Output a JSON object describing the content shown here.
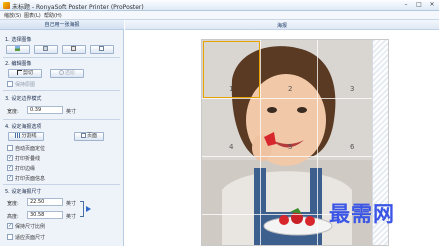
{
  "window": {
    "title": "未标题 - RonyaSoft Poster Printer (ProPoster)",
    "minimize": "–",
    "maximize": "□",
    "close": "✕"
  },
  "menu": {
    "items": [
      "缩放(S)",
      "图表(L)",
      "帮助(H)"
    ]
  },
  "left_panel": {
    "header": "自己用一张海报",
    "step1": {
      "title": "1. 选择图像"
    },
    "step2": {
      "title": "2. 编辑图像",
      "crop": "剪切",
      "restore": "还原",
      "keep_original": "保持原图"
    },
    "step3": {
      "title": "3. 设定边界模式",
      "width_label": "宽度:",
      "width_value": "0.39",
      "width_unit": "英寸"
    },
    "step4": {
      "title": "4. 设定海报选项",
      "segment_btn": "分割线",
      "page_btn": "页面",
      "checks": [
        {
          "label": "自动页面定位",
          "checked": false
        },
        {
          "label": "打印折叠线",
          "checked": true
        },
        {
          "label": "打印边缘",
          "checked": true
        },
        {
          "label": "打印页面信息",
          "checked": true
        }
      ]
    },
    "step5": {
      "title": "5. 设定海报尺寸",
      "width_label": "宽度:",
      "width_value": "22.50",
      "width_unit": "英寸",
      "height_label": "高度:",
      "height_value": "30.58",
      "height_unit": "英寸",
      "keep_ratio": "保持尺寸比例",
      "keep_ratio_checked": true,
      "fit_page": "适应页面尺寸",
      "fit_page_checked": false
    }
  },
  "preview": {
    "header": "海报",
    "tiles": [
      "1",
      "2",
      "3",
      "4",
      "5",
      "6"
    ]
  },
  "watermark": "最需网",
  "colors": {
    "panel_bg": "#eef3fa",
    "accent": "#1f3b66",
    "selection": "#e8a300",
    "watermark": "#3b56e6"
  }
}
